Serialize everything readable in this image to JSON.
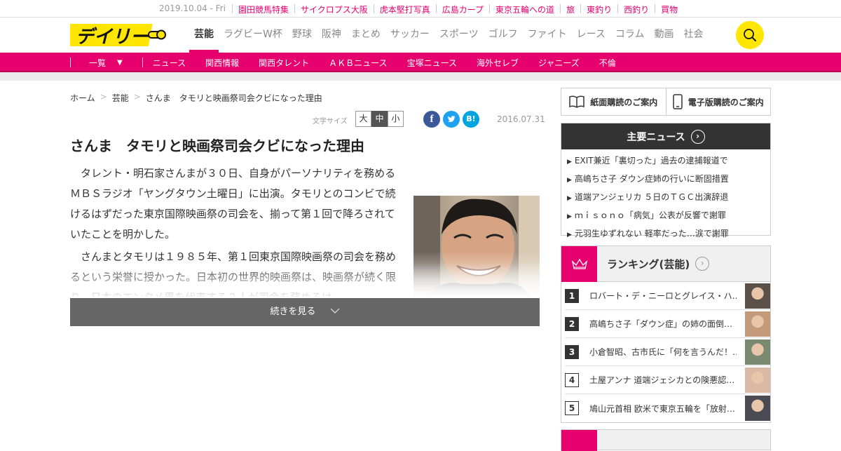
{
  "topbar": {
    "date": "2019.10.04 - Fri",
    "links": [
      "園田競馬特集",
      "サイクロプス大阪",
      "虎本堅打写真",
      "広島カープ",
      "東京五輪への道",
      "旅",
      "東釣り",
      "西釣り",
      "買物"
    ]
  },
  "header": {
    "logo_text": "デイリー",
    "nav": [
      "芸能",
      "ラグビーW杯",
      "野球",
      "阪神",
      "まとめ",
      "サッカー",
      "スポーツ",
      "ゴルフ",
      "ファイト",
      "レース",
      "コラム",
      "動画",
      "社会"
    ],
    "active_nav": "芸能",
    "search_icon": "search-icon"
  },
  "subnav": {
    "all_label": "一覧",
    "items": [
      "ニュース",
      "関西情報",
      "関西タレント",
      "ＡＫＢニュース",
      "宝塚ニュース",
      "海外セレブ",
      "ジャニーズ",
      "不倫"
    ]
  },
  "breadcrumb": [
    "ホーム",
    "芸能",
    "さんま　タモリと映画祭司会クビになった理由"
  ],
  "tools": {
    "font_size_label": "文字サイズ",
    "sizes": [
      "大",
      "中",
      "小"
    ],
    "selected_size": "中",
    "share": [
      "f",
      "t",
      "B!"
    ],
    "date": "2016.07.31"
  },
  "article": {
    "title": "さんま　タモリと映画祭司会クビになった理由",
    "paragraphs": [
      "タレント・明石家さんまが３０日、自身がパーソナリティを務めるＭＢＳラジオ「ヤングタウン土曜日」に出演。タモリとのコンビで続けるはずだった東京国際映画祭の司会を、揃って第１回で降ろされていたことを明かした。",
      "さんまとタモリは１９８５年、第１回東京国際映画祭の司会を務めるという栄誉に授かった。日本初の世界的映画祭は、映画祭が続く限り、日本のエンタメ界を代表する２人が司会を務めるは"
    ],
    "more_label": "続きを見る"
  },
  "sidebar": {
    "subscribe": [
      "紙面購読のご案内",
      "電子版購読のご案内"
    ],
    "main_news_title": "主要ニュース",
    "main_news": [
      "EXIT兼近「裏切った」過去の逮捕報道で",
      "高嶋ちさ子 ダウン症姉の行いに断固措置",
      "道端アンジェリカ ５日のＴＧＣ出演辞退",
      "ｍｉｓｏｎｏ「病気」公表が反響で謝罪",
      "元羽生ゆずれない 軽率だった…涙で謝罪"
    ],
    "ranking_title": "ランキング(芸能)",
    "ranking": [
      {
        "rank": "1",
        "text": "ロバート・デ・ニーロとグレイス・ハ…"
      },
      {
        "rank": "2",
        "text": "高嶋ちさ子「ダウン症」の姉の面倒…"
      },
      {
        "rank": "3",
        "text": "小倉智昭、古市氏に「何を言うんだ！…"
      },
      {
        "rank": "4",
        "text": "土屋アンナ 道端ジェシカとの険悪認…"
      },
      {
        "rank": "5",
        "text": "鳩山元首相 欧米で東京五輪を「放射…"
      }
    ]
  },
  "colors": {
    "accent": "#e5006e",
    "logo_yellow": "#ffe600",
    "dark": "#333333"
  }
}
